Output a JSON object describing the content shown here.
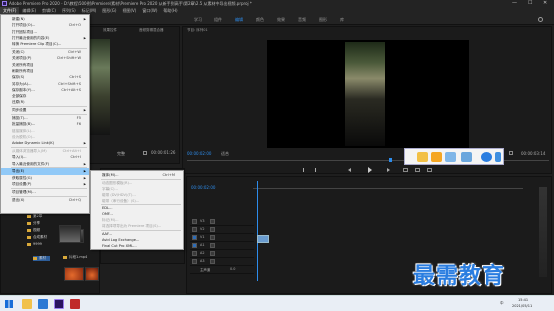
{
  "window": {
    "title": "Adobe Premiere Pro 2020 - D:\\教程\\500例\\Premiere\\素材\\Premiere Pro 2020 从新手到高手\\第2章\\2.5 从素材中导出视频.prproj *",
    "min": "—",
    "max": "☐",
    "close": "✕"
  },
  "menubar": {
    "items": [
      "文件(F)",
      "编辑(E)",
      "剪辑(C)",
      "序列(S)",
      "标记(M)",
      "图形(G)",
      "视图(V)",
      "窗口(W)",
      "帮助(H)"
    ]
  },
  "workspace": {
    "tabs": [
      "学习",
      "组件",
      "编辑",
      "颜色",
      "效果",
      "音频",
      "图形",
      "库"
    ],
    "active_tab": "编辑"
  },
  "file_menu": {
    "items": [
      {
        "label": "新建(N)",
        "shortcut": "",
        "submenu": true,
        "disabled": false
      },
      {
        "label": "打开项目(O)...",
        "shortcut": "Ctrl+O",
        "submenu": false,
        "disabled": false
      },
      {
        "label": "打开团队项目...",
        "shortcut": "",
        "submenu": false,
        "disabled": false
      },
      {
        "label": "打开最近使用的内容(E)",
        "shortcut": "",
        "submenu": true,
        "disabled": false
      },
      {
        "label": "转换 Premiere Clip 项目(C)...",
        "shortcut": "",
        "submenu": false,
        "disabled": false
      },
      {
        "label": "关闭(C)",
        "shortcut": "Ctrl+W",
        "submenu": false,
        "disabled": false
      },
      {
        "label": "关闭项目(P)",
        "shortcut": "Ctrl+Shift+W",
        "submenu": false,
        "disabled": false
      },
      {
        "label": "关闭所有项目",
        "shortcut": "",
        "submenu": false,
        "disabled": false
      },
      {
        "label": "刷新所有项目",
        "shortcut": "",
        "submenu": false,
        "disabled": false
      },
      {
        "label": "保存(S)",
        "shortcut": "Ctrl+S",
        "submenu": false,
        "disabled": false
      },
      {
        "label": "另存为(A)...",
        "shortcut": "Ctrl+Shift+S",
        "submenu": false,
        "disabled": false
      },
      {
        "label": "保存副本(Y)...",
        "shortcut": "Ctrl+Alt+S",
        "submenu": false,
        "disabled": false
      },
      {
        "label": "全部保存",
        "shortcut": "",
        "submenu": false,
        "disabled": false
      },
      {
        "label": "还原(R)",
        "shortcut": "",
        "submenu": false,
        "disabled": false
      },
      {
        "label": "同步设置",
        "shortcut": "",
        "submenu": true,
        "disabled": false
      },
      {
        "label": "捕捉(T)...",
        "shortcut": "F5",
        "submenu": false,
        "disabled": false
      },
      {
        "label": "批量捕捉(B)...",
        "shortcut": "F6",
        "submenu": false,
        "disabled": false
      },
      {
        "label": "链接媒体(L)...",
        "shortcut": "",
        "submenu": false,
        "disabled": true
      },
      {
        "label": "设为脱机(O)...",
        "shortcut": "",
        "submenu": false,
        "disabled": true
      },
      {
        "label": "Adobe Dynamic Link(K)",
        "shortcut": "",
        "submenu": true,
        "disabled": false
      },
      {
        "label": "从媒体浏览器导入(M)",
        "shortcut": "Ctrl+Alt+I",
        "submenu": false,
        "disabled": true
      },
      {
        "label": "导入(I)...",
        "shortcut": "Ctrl+I",
        "submenu": false,
        "disabled": false
      },
      {
        "label": "导入最近使用的文件(F)",
        "shortcut": "",
        "submenu": true,
        "disabled": false
      },
      {
        "label": "导出(E)",
        "shortcut": "",
        "submenu": true,
        "disabled": false,
        "highlighted": true
      },
      {
        "label": "获取属性(G)",
        "shortcut": "",
        "submenu": true,
        "disabled": false
      },
      {
        "label": "项目设置(P)",
        "shortcut": "",
        "submenu": true,
        "disabled": false
      },
      {
        "label": "项目管理(M)...",
        "shortcut": "",
        "submenu": false,
        "disabled": false
      },
      {
        "label": "退出(X)",
        "shortcut": "Ctrl+Q",
        "submenu": false,
        "disabled": false
      }
    ]
  },
  "export_submenu": {
    "items": [
      {
        "label": "媒体(M)...",
        "shortcut": "Ctrl+M",
        "disabled": false
      },
      {
        "label": "动态图形模板(R)...",
        "shortcut": "",
        "disabled": true
      },
      {
        "label": "字幕(C)...",
        "shortcut": "",
        "disabled": true
      },
      {
        "label": "磁带 (DV/HDV)(T)...",
        "shortcut": "",
        "disabled": true
      },
      {
        "label": "磁带（串行设备）(S)...",
        "shortcut": "",
        "disabled": true
      },
      {
        "label": "EDL...",
        "shortcut": "",
        "disabled": false
      },
      {
        "label": "OMF...",
        "shortcut": "",
        "disabled": false
      },
      {
        "label": "标记(M)...",
        "shortcut": "",
        "disabled": true
      },
      {
        "label": "将选择项导出为 Premiere 项目(S)...",
        "shortcut": "",
        "disabled": true
      },
      {
        "label": "AAF...",
        "shortcut": "",
        "disabled": false
      },
      {
        "label": "Avid Log Exchange...",
        "shortcut": "",
        "disabled": false
      },
      {
        "label": "Final Cut Pro XML...",
        "shortcut": "",
        "disabled": false
      }
    ]
  },
  "source_monitor": {
    "tab": "效果控件",
    "tab2": "音频剪辑混合器",
    "timecode": "00:00:00:00",
    "end_timecode": "00:00:01:26",
    "zoom": "完整"
  },
  "program_monitor": {
    "tab": "节目: 序列01",
    "timecode": "00:00:02:00",
    "fit": "适合",
    "quality": "完整",
    "end_timecode": "00:00:03:14"
  },
  "timeline": {
    "timecode": "00:00:02:00",
    "tracks": [
      "V3",
      "V2",
      "V1",
      "A1",
      "A2",
      "A3"
    ],
    "master": "主声道",
    "master_value": "0.0"
  },
  "project": {
    "folders": [
      "第2章",
      "分享",
      "视频",
      "合成素材",
      "9999"
    ],
    "selected_folder": "素材",
    "clip1": "片段1.mp4",
    "clip2": "片段2.mp4"
  },
  "taskbar": {
    "time": "15:41",
    "date": "2021/05/11",
    "lang": "中"
  },
  "watermark": {
    "text": "最需教育"
  }
}
